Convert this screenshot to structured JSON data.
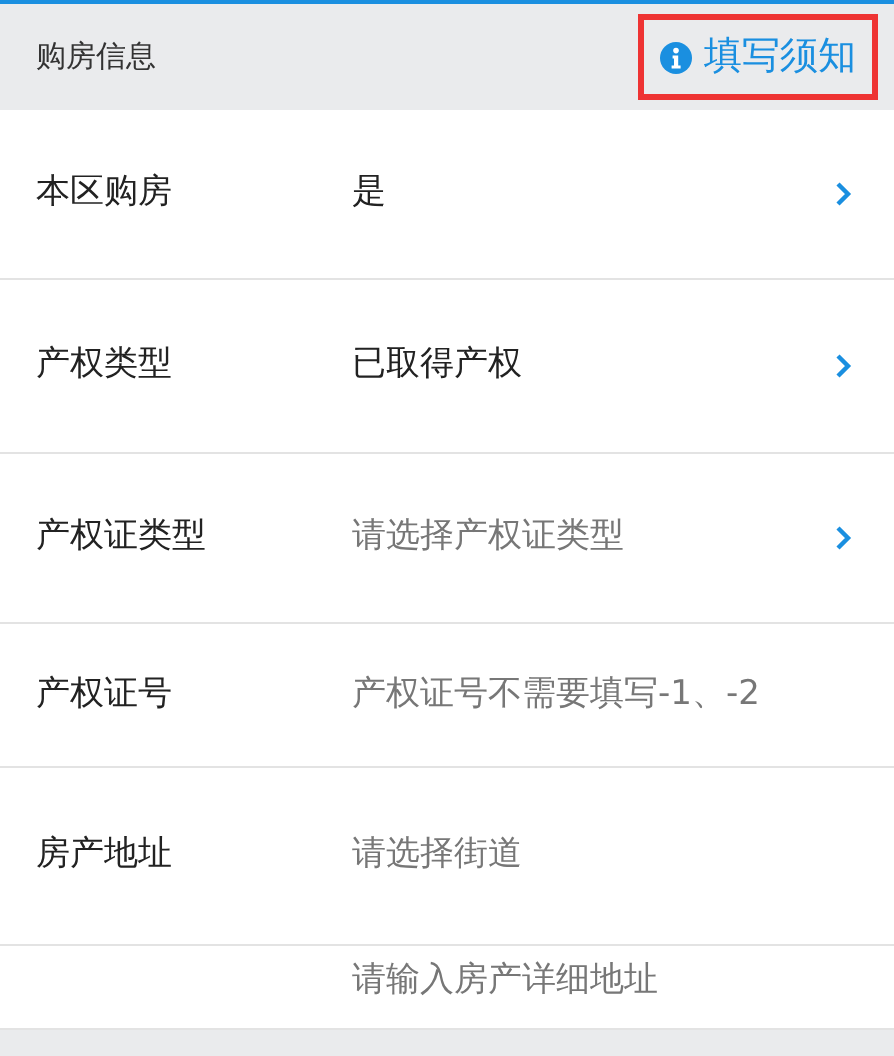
{
  "header": {
    "title": "购房信息",
    "notice_link": "填写须知"
  },
  "rows": [
    {
      "kind": "select",
      "label": "本区购房",
      "value": "是"
    },
    {
      "kind": "select",
      "label": "产权类型",
      "value": "已取得产权"
    },
    {
      "kind": "select",
      "label": "产权证类型",
      "placeholder": "请选择产权证类型"
    },
    {
      "kind": "input",
      "label": "产权证号",
      "placeholder": "产权证号不需要填写-1、-2"
    },
    {
      "kind": "input",
      "label": "房产地址",
      "placeholder": "请选择街道"
    },
    {
      "kind": "input",
      "placeholder": "请输入房产详细地址"
    }
  ]
}
